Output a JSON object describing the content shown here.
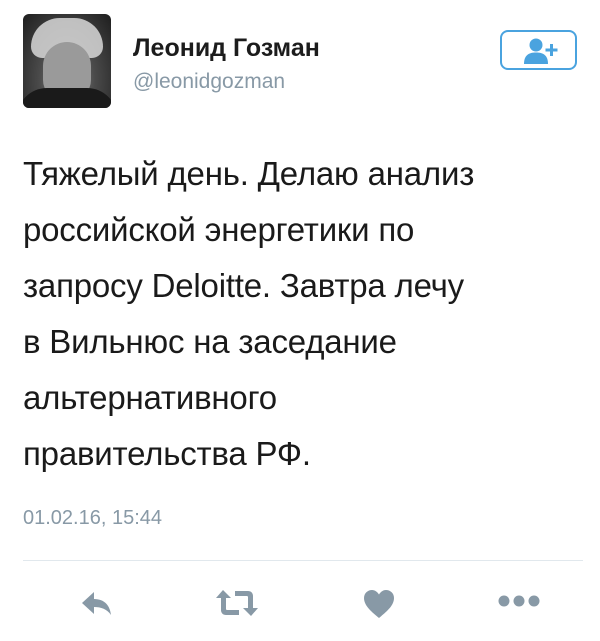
{
  "author": {
    "name": "Леонид Гозман",
    "handle": "@leonidgozman"
  },
  "tweet": {
    "lines": [
      "Тяжелый день. Делаю анализ",
      "российской энергетики по",
      "запросу Deloitte. Завтра лечу",
      "в Вильнюс на заседание",
      "альтернативного",
      "правительства РФ."
    ],
    "timestamp": "01.02.16, 15:44"
  },
  "icons": {
    "follow": "add-user-icon",
    "reply": "reply-icon",
    "retweet": "retweet-icon",
    "like": "heart-icon",
    "more": "more-icon"
  },
  "colors": {
    "accent": "#4aa3df",
    "action_gray": "#8899a6",
    "text": "#1a1a1a"
  }
}
